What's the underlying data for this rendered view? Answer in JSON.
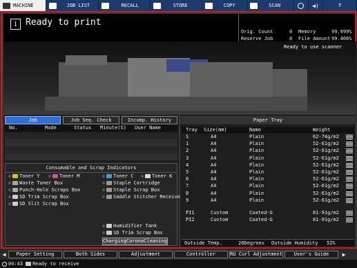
{
  "topbar": {
    "tabs": [
      {
        "label": "MACHINE",
        "icon": "machine-icon",
        "active": true
      },
      {
        "label": "JOB LIST",
        "icon": "job-list-icon"
      },
      {
        "label": "RECALL",
        "icon": "recall-icon"
      },
      {
        "label": "STORE",
        "icon": "store-icon"
      },
      {
        "label": "COPY",
        "icon": "copy-icon"
      },
      {
        "label": "SCAN",
        "icon": "scan-icon"
      }
    ],
    "right_icons": [
      "globe-icon",
      "volume-icon",
      "help-icon"
    ],
    "help_label": "?"
  },
  "status": {
    "message": "Ready to print",
    "info_glyph": "i",
    "scanner": "Ready to use scanner"
  },
  "counters": {
    "orig_count_label": "Orig. Count",
    "orig_count": "0",
    "reserve_job_label": "Reserve Job",
    "reserve_job": "0",
    "memory_label": "Memory",
    "memory": "99.999%",
    "file_amount_label": "File Amount",
    "file_amount": "99.406%"
  },
  "job_panel": {
    "tabs": [
      "Job",
      "Job Seq. Check",
      "Incomp. History"
    ],
    "columns": [
      "No.",
      "Mode",
      "Status",
      "Minute(S)",
      "User Name"
    ]
  },
  "consumables": {
    "title": "Consumable and Scrap Indicators",
    "items_left": [
      "Toner Y",
      "Toner M",
      "Waste Toner Box",
      "Punch-Hole Scraps Box",
      "SD Trim Scrap Box",
      "SD Slit Scrap Box"
    ],
    "items_right": [
      "Toner C",
      "Toner K",
      "Staple Cartridge",
      "Staple Scrap Box",
      "Saddle Stitcher Receiver",
      "Humidifier Tank",
      "SD Trim Scrap Box"
    ],
    "cleaning_button": "ChargingCoronaCleaning"
  },
  "paper_tray": {
    "title": "Paper Tray",
    "columns": [
      "Tray",
      "Size(mm)",
      "Name",
      "Weight"
    ],
    "rows": [
      {
        "tray": "S",
        "size": "A4",
        "name": "Plain",
        "weight": "62-74g/m2"
      },
      {
        "tray": "1",
        "size": "A4",
        "name": "Plain",
        "weight": "52-61g/m2"
      },
      {
        "tray": "2",
        "size": "A4",
        "name": "Plain",
        "weight": "52-61g/m2"
      },
      {
        "tray": "3",
        "size": "A4",
        "name": "Plain",
        "weight": "52-61g/m2"
      },
      {
        "tray": "4",
        "size": "A4",
        "name": "Plain",
        "weight": "52-61g/m2"
      },
      {
        "tray": "5",
        "size": "A4",
        "name": "Plain",
        "weight": "52-61g/m2"
      },
      {
        "tray": "6",
        "size": "A4",
        "name": "Plain",
        "weight": "52-61g/m2"
      },
      {
        "tray": "7",
        "size": "A4",
        "name": "Plain",
        "weight": "52-61g/m2"
      },
      {
        "tray": "8",
        "size": "A4",
        "name": "Plain",
        "weight": "52-61g/m2"
      },
      {
        "tray": "9",
        "size": "A4",
        "name": "Plain",
        "weight": "52-61g/m2"
      },
      {
        "tray": "PI1",
        "size": "Custom",
        "name": "Coated-G",
        "weight": "81-91g/m2"
      },
      {
        "tray": "PI2",
        "size": "Custom",
        "name": "Coated-G",
        "weight": "81-91g/m2"
      }
    ],
    "outside_temp_label": "Outside Temp.",
    "outside_temp": "26Degrees",
    "outside_humidity_label": "Outside Humidity",
    "outside_humidity": "52%"
  },
  "bottom_buttons": [
    "Paper Setting",
    "Both Sides",
    "Adjustment",
    "Controller",
    "RU Curl Adjustment",
    "User's Guide"
  ],
  "bottom_arrows": [
    "◀",
    "▶"
  ],
  "footer": {
    "time": "04:43",
    "status": "Ready to receive"
  },
  "colors": {
    "topbar": "#1b3a6e",
    "frame_border": "#d01c1c",
    "active_tab": "#2f6fd6",
    "toner_y": "#e0c020",
    "toner_m": "#d050a0",
    "toner_c": "#3aa0e0",
    "toner_k": "#dddddd"
  }
}
